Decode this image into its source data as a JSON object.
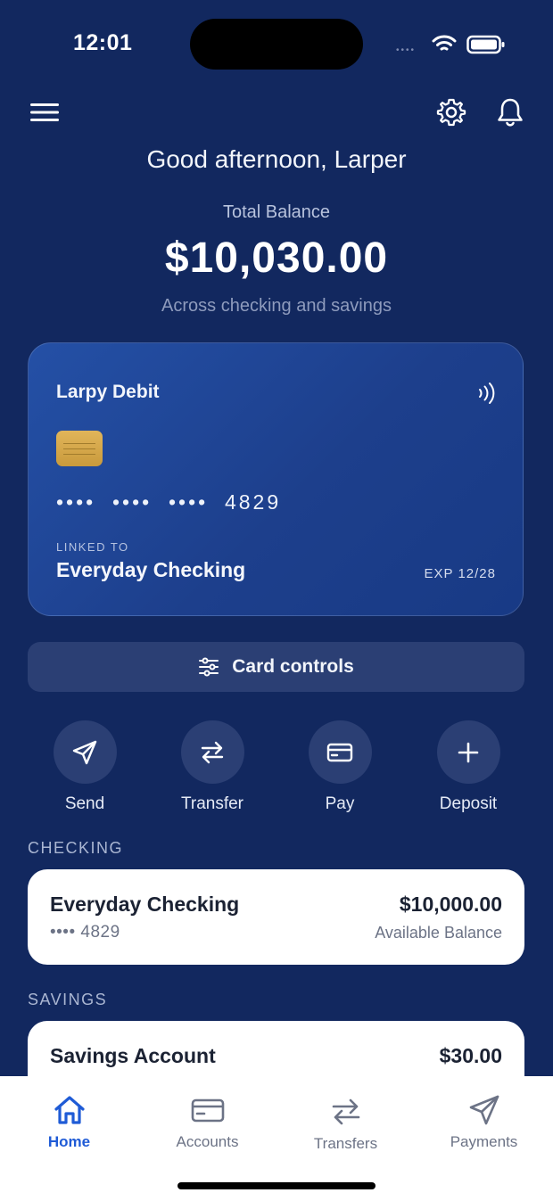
{
  "status_bar": {
    "time": "12:01",
    "signal": "••••"
  },
  "header": {
    "greeting": "Good afternoon, Larper",
    "balance_label": "Total Balance",
    "balance_value": "$10,030.00",
    "balance_sub": "Across checking and savings"
  },
  "card": {
    "name": "Larpy Debit",
    "number": "••••  ••••  ••••  4829",
    "linked_label": "LINKED TO",
    "linked_account": "Everyday Checking",
    "expiry": "EXP  12/28"
  },
  "card_controls_label": "Card controls",
  "actions": [
    {
      "label": "Send",
      "icon": "send-icon"
    },
    {
      "label": "Transfer",
      "icon": "transfer-icon"
    },
    {
      "label": "Pay",
      "icon": "card-icon"
    },
    {
      "label": "Deposit",
      "icon": "plus-icon"
    }
  ],
  "sections": {
    "checking": "CHECKING",
    "savings": "SAVINGS"
  },
  "accounts": {
    "checking": {
      "name": "Everyday Checking",
      "number": "•••• 4829",
      "amount": "$10,000.00",
      "sub": "Available Balance"
    },
    "savings": {
      "name": "Savings Account",
      "amount": "$30.00"
    }
  },
  "tabs": [
    {
      "label": "Home",
      "icon": "home-icon",
      "active": true
    },
    {
      "label": "Accounts",
      "icon": "accounts-icon",
      "active": false
    },
    {
      "label": "Transfers",
      "icon": "transfers-icon",
      "active": false
    },
    {
      "label": "Payments",
      "icon": "payments-icon",
      "active": false
    }
  ],
  "colors": {
    "background": "#12285f",
    "card_gradient_start": "#2450a6",
    "tab_active": "#1f5bd6",
    "action_circle": "#2b3f74"
  }
}
